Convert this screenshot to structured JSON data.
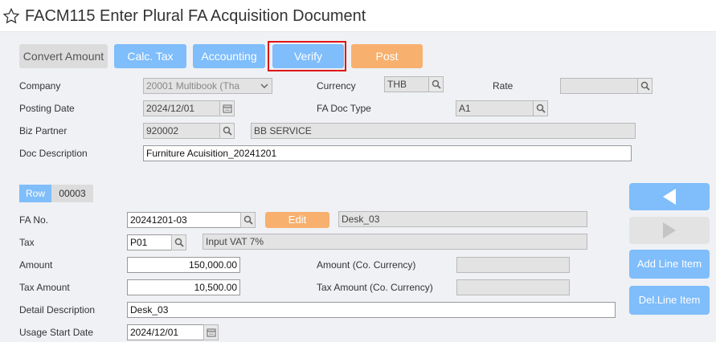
{
  "window": {
    "title": "FACM115 Enter Plural FA Acquisition Document"
  },
  "toolbar": {
    "convert_amount": "Convert Amount",
    "calc_tax": "Calc. Tax",
    "accounting": "Accounting",
    "verify": "Verify",
    "post": "Post"
  },
  "header": {
    "company_label": "Company",
    "company_value": "20001 Multibook (Tha",
    "currency_label": "Currency",
    "currency_value": "THB",
    "rate_label": "Rate",
    "rate_value": "",
    "posting_date_label": "Posting Date",
    "posting_date_value": "2024/12/01",
    "fa_doc_type_label": "FA Doc Type",
    "fa_doc_type_value": "A1",
    "biz_partner_label": "Biz Partner",
    "biz_partner_code": "920002",
    "biz_partner_name": "BB SERVICE",
    "doc_description_label": "Doc Description",
    "doc_description_value": "Furniture Acuisition_20241201"
  },
  "line": {
    "row_tab": "Row",
    "row_number": "00003",
    "fa_no_label": "FA No.",
    "fa_no_value": "20241201-03",
    "edit_button": "Edit",
    "fa_name": "Desk_03",
    "tax_label": "Tax",
    "tax_code": "P01",
    "tax_name": "Input VAT 7%",
    "amount_label": "Amount",
    "amount_value": "150,000.00",
    "amount_co_label": "Amount (Co. Currency)",
    "amount_co_value": "",
    "tax_amount_label": "Tax Amount",
    "tax_amount_value": "10,500.00",
    "tax_amount_co_label": "Tax Amount (Co. Currency)",
    "tax_amount_co_value": "",
    "detail_description_label": "Detail Description",
    "detail_description_value": "Desk_03",
    "usage_start_date_label": "Usage Start Date",
    "usage_start_date_value": "2024/12/01"
  },
  "side": {
    "add_line_item": "Add Line Item",
    "del_line_item": "Del.Line Item"
  },
  "colors": {
    "accent_blue": "#7fbdfb",
    "accent_orange": "#f7b06e",
    "highlight_red": "#e01515"
  },
  "icons": [
    "star-icon",
    "chevron-down-icon",
    "search-icon",
    "calendar-icon",
    "arrow-left-icon",
    "arrow-right-icon"
  ]
}
